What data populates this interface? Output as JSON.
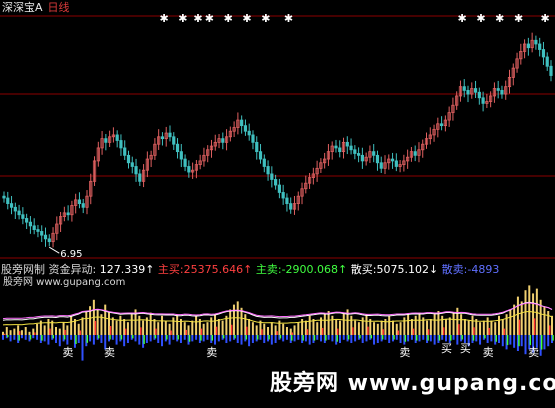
{
  "header": {
    "stock_name": "深深宝A",
    "period": "日线"
  },
  "indicator": {
    "name": "股旁网制 资金异动:",
    "capital_flow": "127.339↑",
    "main_buy_label": "主买:",
    "main_buy": "25375.646↑",
    "main_sell_label": "主卖:",
    "main_sell": "-2900.068↑",
    "retail_buy_label": "散买:",
    "retail_buy": "5075.102↓",
    "retail_sell_label": "散卖:",
    "retail_sell": "-4893"
  },
  "watermark_small": "股旁网 www.gupang.com",
  "watermark_large": "股旁网 www.gupang.com",
  "chart_data": [
    {
      "type": "candlestick",
      "title": "日线",
      "min_label": "6.95",
      "x_count": 150,
      "close": [
        9.3,
        9.0,
        8.8,
        8.6,
        8.4,
        8.2,
        8.0,
        7.8,
        7.6,
        7.5,
        7.3,
        7.1,
        6.95,
        7.4,
        7.9,
        8.3,
        8.5,
        8.4,
        8.9,
        9.2,
        9.0,
        8.8,
        9.4,
        10.2,
        11.3,
        12.0,
        12.5,
        12.3,
        12.6,
        12.7,
        12.4,
        12.0,
        11.6,
        11.2,
        11.0,
        10.6,
        10.2,
        10.8,
        11.4,
        11.6,
        12.2,
        12.6,
        12.5,
        12.8,
        12.6,
        12.2,
        11.8,
        11.4,
        11.0,
        10.7,
        10.8,
        11.1,
        11.3,
        11.6,
        11.9,
        12.1,
        12.3,
        12.5,
        12.3,
        12.6,
        12.9,
        13.1,
        13.5,
        13.2,
        12.9,
        12.7,
        12.3,
        11.8,
        11.4,
        11.0,
        10.6,
        10.3,
        10.0,
        9.6,
        9.3,
        9.0,
        8.7,
        9.0,
        9.4,
        9.8,
        10.1,
        10.4,
        10.6,
        10.9,
        11.2,
        11.4,
        11.8,
        12.1,
        12.0,
        11.8,
        12.3,
        12.1,
        11.9,
        11.7,
        11.6,
        11.3,
        11.5,
        11.8,
        11.6,
        11.2,
        10.9,
        11.2,
        11.4,
        11.3,
        11.0,
        11.1,
        11.3,
        11.5,
        11.8,
        11.6,
        11.9,
        12.2,
        12.5,
        12.7,
        13.0,
        13.3,
        13.2,
        13.5,
        13.9,
        14.3,
        14.8,
        15.3,
        15.1,
        14.9,
        15.2,
        15.0,
        14.7,
        14.4,
        14.5,
        14.8,
        15.2,
        15.1,
        14.9,
        15.3,
        15.8,
        16.3,
        16.8,
        17.2,
        17.6,
        17.4,
        17.8,
        17.6,
        17.3,
        16.9,
        16.4,
        15.9
      ],
      "signal_marks": [
        42,
        47,
        51,
        54,
        59,
        64,
        69,
        75,
        121,
        126,
        131,
        136,
        143
      ]
    },
    {
      "type": "bar",
      "title": "资金异动",
      "series": [
        {
          "values": [
            0.2,
            0.5,
            0.3,
            0.4,
            0.6,
            0.3,
            0.5,
            0.2,
            0.4,
            0.7,
            0.9,
            0.6,
            1.0,
            0.9,
            0.5,
            0.4,
            0.8,
            0.6,
            1.2,
            1.0,
            0.7,
            1.1,
            1.5,
            1.8,
            2.2,
            1.6,
            1.3,
            1.9,
            1.4,
            1.1,
            0.9,
            1.2,
            1.0,
            0.8,
            1.3,
            1.6,
            1.2,
            0.9,
            1.1,
            1.4,
            1.0,
            0.8,
            1.2,
            0.9,
            0.7,
            1.1,
            1.3,
            1.0,
            0.8,
            0.6,
            0.9,
            1.2,
            1.0,
            0.7,
            0.8,
            1.1,
            1.3,
            1.0,
            0.9,
            1.2,
            1.6,
            1.9,
            2.1,
            1.7,
            1.3,
            1.0,
            0.8,
            0.6,
            0.9,
            0.7,
            0.5,
            0.8,
            0.6,
            0.9,
            0.7,
            0.5,
            0.4,
            0.6,
            0.8,
            1.0,
            0.9,
            1.2,
            1.0,
            0.8,
            1.1,
            1.3,
            1.5,
            1.2,
            1.0,
            0.9,
            1.4,
            1.6,
            1.2,
            0.9,
            0.8,
            1.1,
            1.3,
            1.0,
            0.8,
            0.7,
            0.9,
            1.0,
            1.2,
            0.9,
            0.7,
            0.8,
            1.1,
            1.3,
            1.0,
            1.2,
            1.4,
            1.1,
            0.9,
            1.0,
            1.3,
            1.5,
            1.2,
            1.0,
            1.1,
            1.4,
            1.7,
            1.3,
            1.0,
            0.9,
            1.2,
            1.0,
            0.8,
            0.9,
            1.1,
            0.9,
            0.8,
            1.2,
            1.0,
            1.3,
            1.6,
            1.9,
            2.4,
            2.1,
            2.8,
            3.1,
            2.6,
            2.9,
            2.2,
            1.8,
            1.5,
            1.2
          ]
        },
        {
          "values": [
            -0.3,
            -0.2,
            -0.4,
            -0.3,
            -0.5,
            -0.2,
            -0.3,
            -0.4,
            -0.2,
            -0.3,
            -0.5,
            -0.4,
            -0.6,
            -0.3,
            -0.5,
            -0.7,
            -0.4,
            -0.6,
            -0.3,
            -0.8,
            -0.5,
            -1.6,
            -0.7,
            -0.4,
            -0.6,
            -0.3,
            -0.5,
            -0.9,
            -0.4,
            -0.3,
            -0.6,
            -0.4,
            -0.7,
            -0.5,
            -0.3,
            -0.4,
            -0.6,
            -0.8,
            -0.5,
            -0.4,
            -0.3,
            -0.5,
            -0.7,
            -0.4,
            -0.6,
            -0.3,
            -0.4,
            -0.5,
            -0.3,
            -0.6,
            -0.4,
            -0.3,
            -0.5,
            -0.4,
            -0.3,
            -0.5,
            -0.6,
            -0.4,
            -0.3,
            -0.5,
            -0.4,
            -0.3,
            -0.5,
            -0.6,
            -0.4,
            -0.7,
            -0.5,
            -0.4,
            -0.3,
            -0.5,
            -0.4,
            -0.6,
            -0.5,
            -0.3,
            -0.4,
            -0.3,
            -0.5,
            -0.4,
            -0.3,
            -0.5,
            -0.4,
            -0.6,
            -0.5,
            -0.3,
            -0.4,
            -0.5,
            -0.3,
            -0.4,
            -0.6,
            -0.5,
            -0.3,
            -0.4,
            -0.5,
            -0.4,
            -0.3,
            -0.5,
            -0.4,
            -0.3,
            -0.6,
            -0.5,
            -0.4,
            -0.3,
            -0.5,
            -0.4,
            -0.3,
            -0.5,
            -0.6,
            -0.4,
            -0.3,
            -0.5,
            -0.4,
            -0.3,
            -0.5,
            -0.4,
            -0.6,
            -0.5,
            -0.3,
            -0.4,
            -0.5,
            -0.3,
            -0.6,
            -0.4,
            -0.5,
            -0.7,
            -0.5,
            -0.4,
            -0.6,
            -0.3,
            -0.5,
            -0.4,
            -0.6,
            -0.5,
            -0.7,
            -0.9,
            -0.6,
            -0.8,
            -1.0,
            -0.7,
            -1.2,
            -0.9,
            -1.1,
            -0.8,
            -1.3,
            -0.9,
            -0.7,
            -0.5
          ]
        }
      ],
      "sell_labels": [
        {
          "x": 17,
          "text": "卖"
        },
        {
          "x": 28,
          "text": "卖"
        },
        {
          "x": 55,
          "text": "卖"
        },
        {
          "x": 106,
          "text": "卖"
        },
        {
          "x": 140,
          "text": "卖"
        },
        {
          "x": 148,
          "text": "卖"
        },
        {
          "x": 128,
          "text": "卖"
        }
      ],
      "buy_labels": [
        {
          "x": 117,
          "text": "买"
        },
        {
          "x": 122,
          "text": "买"
        }
      ]
    }
  ],
  "colors": {
    "up": "#e06060",
    "down": "#40c0c0",
    "grid": "#8b0000",
    "pos": "#f0d070",
    "neg": "#3050ff",
    "green": "#40ff40"
  }
}
